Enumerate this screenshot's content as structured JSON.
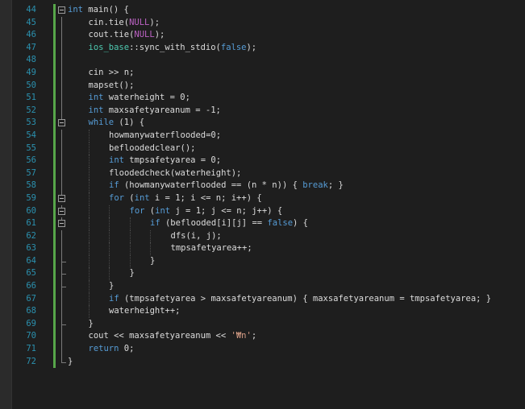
{
  "editor": {
    "colors": {
      "background": "#1e1e1e",
      "line_number": "#2b91af",
      "keyword": "#569cd6",
      "macro": "#bd63c5",
      "type": "#4ec9b0",
      "string": "#d69d85",
      "change_bar": "#57a64a"
    },
    "lines": [
      {
        "n": "44",
        "indent": 0,
        "fold": "open",
        "tokens": [
          {
            "t": "int",
            "c": "kw"
          },
          {
            "t": " main() {",
            "c": "id"
          }
        ]
      },
      {
        "n": "45",
        "indent": 1,
        "tokens": [
          {
            "t": "cin.tie(",
            "c": "id"
          },
          {
            "t": "NULL",
            "c": "mac"
          },
          {
            "t": ");",
            "c": "id"
          }
        ]
      },
      {
        "n": "46",
        "indent": 1,
        "tokens": [
          {
            "t": "cout.tie(",
            "c": "id"
          },
          {
            "t": "NULL",
            "c": "mac"
          },
          {
            "t": ");",
            "c": "id"
          }
        ]
      },
      {
        "n": "47",
        "indent": 1,
        "tokens": [
          {
            "t": "ios_base",
            "c": "ty"
          },
          {
            "t": "::sync_with_stdio(",
            "c": "id"
          },
          {
            "t": "false",
            "c": "kw"
          },
          {
            "t": ");",
            "c": "id"
          }
        ]
      },
      {
        "n": "48",
        "indent": 1,
        "tokens": []
      },
      {
        "n": "49",
        "indent": 1,
        "tokens": [
          {
            "t": "cin >> n;",
            "c": "id"
          }
        ]
      },
      {
        "n": "50",
        "indent": 1,
        "tokens": [
          {
            "t": "mapset();",
            "c": "id"
          }
        ]
      },
      {
        "n": "51",
        "indent": 1,
        "tokens": [
          {
            "t": "int",
            "c": "kw"
          },
          {
            "t": " waterheight = 0;",
            "c": "id"
          }
        ]
      },
      {
        "n": "52",
        "indent": 1,
        "tokens": [
          {
            "t": "int",
            "c": "kw"
          },
          {
            "t": " maxsafetyareanum = -1;",
            "c": "id"
          }
        ]
      },
      {
        "n": "53",
        "indent": 1,
        "fold": "open",
        "tokens": [
          {
            "t": "while",
            "c": "kw"
          },
          {
            "t": " (1) {",
            "c": "id"
          }
        ]
      },
      {
        "n": "54",
        "indent": 2,
        "tokens": [
          {
            "t": "howmanywaterflooded=0;",
            "c": "id"
          }
        ]
      },
      {
        "n": "55",
        "indent": 2,
        "tokens": [
          {
            "t": "befloodedclear();",
            "c": "id"
          }
        ]
      },
      {
        "n": "56",
        "indent": 2,
        "tokens": [
          {
            "t": "int",
            "c": "kw"
          },
          {
            "t": " tmpsafetyarea = 0;",
            "c": "id"
          }
        ]
      },
      {
        "n": "57",
        "indent": 2,
        "tokens": [
          {
            "t": "floodedcheck(waterheight);",
            "c": "id"
          }
        ]
      },
      {
        "n": "58",
        "indent": 2,
        "tokens": [
          {
            "t": "if",
            "c": "kw"
          },
          {
            "t": " (howmanywaterflooded == (n * n)) { ",
            "c": "id"
          },
          {
            "t": "break",
            "c": "kw"
          },
          {
            "t": "; }",
            "c": "id"
          }
        ]
      },
      {
        "n": "59",
        "indent": 2,
        "fold": "open",
        "tokens": [
          {
            "t": "for",
            "c": "kw"
          },
          {
            "t": " (",
            "c": "id"
          },
          {
            "t": "int",
            "c": "kw"
          },
          {
            "t": " i = 1; i <= n; i++) {",
            "c": "id"
          }
        ]
      },
      {
        "n": "60",
        "indent": 3,
        "fold": "open",
        "tokens": [
          {
            "t": "for",
            "c": "kw"
          },
          {
            "t": " (",
            "c": "id"
          },
          {
            "t": "int",
            "c": "kw"
          },
          {
            "t": " j = 1; j <= n; j++) {",
            "c": "id"
          }
        ]
      },
      {
        "n": "61",
        "indent": 4,
        "fold": "open",
        "tokens": [
          {
            "t": "if",
            "c": "kw"
          },
          {
            "t": " (beflooded[i][j] == ",
            "c": "id"
          },
          {
            "t": "false",
            "c": "kw"
          },
          {
            "t": ") {",
            "c": "id"
          }
        ]
      },
      {
        "n": "62",
        "indent": 5,
        "tokens": [
          {
            "t": "dfs(i, j);",
            "c": "id"
          }
        ]
      },
      {
        "n": "63",
        "indent": 5,
        "tokens": [
          {
            "t": "tmpsafetyarea++;",
            "c": "id"
          }
        ]
      },
      {
        "n": "64",
        "indent": 4,
        "fend": true,
        "tokens": [
          {
            "t": "}",
            "c": "id"
          }
        ]
      },
      {
        "n": "65",
        "indent": 3,
        "fend": true,
        "tokens": [
          {
            "t": "}",
            "c": "id"
          }
        ]
      },
      {
        "n": "66",
        "indent": 2,
        "fend": true,
        "tokens": [
          {
            "t": "}",
            "c": "id"
          }
        ]
      },
      {
        "n": "67",
        "indent": 2,
        "tokens": [
          {
            "t": "if",
            "c": "kw"
          },
          {
            "t": " (tmpsafetyarea > maxsafetyareanum) { maxsafetyareanum = tmpsafetyarea; }",
            "c": "id"
          }
        ]
      },
      {
        "n": "68",
        "indent": 2,
        "tokens": [
          {
            "t": "waterheight++;",
            "c": "id"
          }
        ]
      },
      {
        "n": "69",
        "indent": 1,
        "fend": true,
        "tokens": [
          {
            "t": "}",
            "c": "id"
          }
        ]
      },
      {
        "n": "70",
        "indent": 1,
        "tokens": [
          {
            "t": "cout << maxsafetyareanum << ",
            "c": "id"
          },
          {
            "t": "'₩n'",
            "c": "str"
          },
          {
            "t": ";",
            "c": "id"
          }
        ]
      },
      {
        "n": "71",
        "indent": 1,
        "tokens": [
          {
            "t": "return",
            "c": "kw"
          },
          {
            "t": " 0;",
            "c": "id"
          }
        ]
      },
      {
        "n": "72",
        "indent": 0,
        "fend": true,
        "tokens": [
          {
            "t": "}",
            "c": "id"
          }
        ]
      }
    ]
  }
}
